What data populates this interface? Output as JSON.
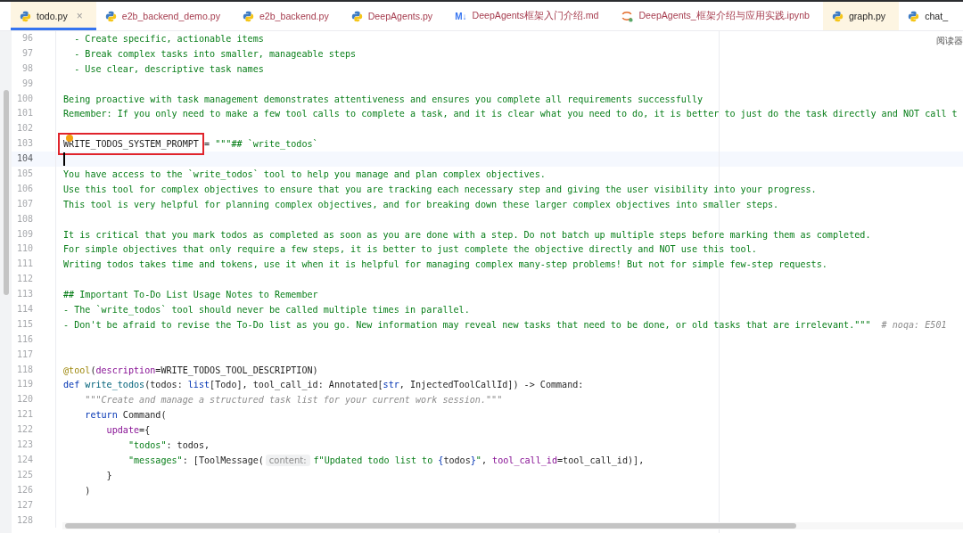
{
  "tabs": [
    {
      "label": "todo.py",
      "kind": "python",
      "selected": true,
      "highlighted": true,
      "close": "×",
      "unversioned": false
    },
    {
      "label": "e2b_backend_demo.py",
      "kind": "python",
      "selected": false,
      "highlighted": false,
      "unversioned": true
    },
    {
      "label": "e2b_backend.py",
      "kind": "python",
      "selected": false,
      "highlighted": false,
      "unversioned": true
    },
    {
      "label": "DeepAgents.py",
      "kind": "python",
      "selected": false,
      "highlighted": false,
      "unversioned": true
    },
    {
      "label": "DeepAgents框架入门介绍.md",
      "kind": "markdown",
      "badge": "M↓",
      "selected": false,
      "highlighted": false,
      "unversioned": true
    },
    {
      "label": "DeepAgents_框架介绍与应用实践.ipynb",
      "kind": "jupyter",
      "selected": false,
      "highlighted": false,
      "unversioned": true
    },
    {
      "label": "graph.py",
      "kind": "python",
      "selected": false,
      "highlighted": true,
      "unversioned": false
    },
    {
      "label": "chat_",
      "kind": "python",
      "selected": false,
      "highlighted": false,
      "unversioned": false
    }
  ],
  "reader_mode": "阅读器",
  "lines": [
    {
      "number": "96",
      "current": false,
      "caret": false,
      "marker": false,
      "tokens": [
        {
          "kind": "str",
          "text": "  - Create specific, actionable items"
        }
      ]
    },
    {
      "number": "97",
      "current": false,
      "caret": false,
      "marker": false,
      "tokens": [
        {
          "kind": "str",
          "text": "  - Break complex tasks into smaller, manageable steps"
        }
      ]
    },
    {
      "number": "98",
      "current": false,
      "caret": false,
      "marker": false,
      "tokens": [
        {
          "kind": "str",
          "text": "  - Use clear, descriptive task names"
        }
      ]
    },
    {
      "number": "99",
      "current": false,
      "caret": false,
      "marker": false
    },
    {
      "number": "100",
      "current": false,
      "caret": false,
      "marker": false,
      "tokens": [
        {
          "kind": "str",
          "text": "Being proactive with task management demonstrates attentiveness and ensures you complete all requirements successfully"
        }
      ]
    },
    {
      "number": "101",
      "current": false,
      "caret": false,
      "marker": false,
      "tokens": [
        {
          "kind": "str",
          "text": "Remember: If you only need to make a few tool calls to complete a task, and it is clear what you need to do, it is better to just do the task directly and NOT call t"
        }
      ]
    },
    {
      "number": "102",
      "current": false,
      "caret": false,
      "marker": false
    },
    {
      "number": "103",
      "current": false,
      "caret": false,
      "marker": true,
      "tokens": [
        {
          "kind": "plain",
          "text": "WRITE_TODOS_SYSTEM_PROMPT",
          "boxed": true
        },
        {
          "kind": "plain",
          "text": " = "
        },
        {
          "kind": "str",
          "text": "\"\"\"## `write_todos`"
        }
      ]
    },
    {
      "number": "104",
      "current": true,
      "caret": true,
      "marker": false
    },
    {
      "number": "105",
      "current": false,
      "caret": false,
      "marker": false,
      "tokens": [
        {
          "kind": "str",
          "text": "You have access to the `write_todos` tool to help you manage and plan complex objectives."
        }
      ]
    },
    {
      "number": "106",
      "current": false,
      "caret": false,
      "marker": false,
      "tokens": [
        {
          "kind": "str",
          "text": "Use this tool for complex objectives to ensure that you are tracking each necessary step and giving the user visibility into your progress."
        }
      ]
    },
    {
      "number": "107",
      "current": false,
      "caret": false,
      "marker": false,
      "tokens": [
        {
          "kind": "str",
          "text": "This tool is very helpful for planning complex objectives, and for breaking down these larger complex objectives into smaller steps."
        }
      ]
    },
    {
      "number": "108",
      "current": false,
      "caret": false,
      "marker": false
    },
    {
      "number": "109",
      "current": false,
      "caret": false,
      "marker": false,
      "tokens": [
        {
          "kind": "str",
          "text": "It is critical that you mark todos as completed as soon as you are done with a step. Do not batch up multiple steps before marking them as completed."
        }
      ]
    },
    {
      "number": "110",
      "current": false,
      "caret": false,
      "marker": false,
      "tokens": [
        {
          "kind": "str",
          "text": "For simple objectives that only require a few steps, it is better to just complete the objective directly and NOT use this tool."
        }
      ]
    },
    {
      "number": "111",
      "current": false,
      "caret": false,
      "marker": false,
      "tokens": [
        {
          "kind": "str",
          "text": "Writing todos takes time and tokens, use it when it is helpful for managing complex many-step problems! But not for simple few-step requests."
        }
      ]
    },
    {
      "number": "112",
      "current": false,
      "caret": false,
      "marker": false
    },
    {
      "number": "113",
      "current": false,
      "caret": false,
      "marker": false,
      "tokens": [
        {
          "kind": "str",
          "text": "## Important To-Do List Usage Notes to Remember"
        }
      ]
    },
    {
      "number": "114",
      "current": false,
      "caret": false,
      "marker": false,
      "tokens": [
        {
          "kind": "str",
          "text": "- The `write_todos` tool should never be called multiple times in parallel."
        }
      ]
    },
    {
      "number": "115",
      "current": false,
      "caret": false,
      "marker": false,
      "tokens": [
        {
          "kind": "str",
          "text": "- Don't be afraid to revise the To-Do list as you go. New information may reveal new tasks that need to be done, or old tasks that are irrelevant.\"\"\""
        },
        {
          "kind": "comment",
          "text": "  # noqa: E501"
        }
      ]
    },
    {
      "number": "116",
      "current": false,
      "caret": false,
      "marker": false
    },
    {
      "number": "117",
      "current": false,
      "caret": false,
      "marker": false
    },
    {
      "number": "118",
      "current": false,
      "caret": false,
      "marker": false,
      "tokens": [
        {
          "kind": "decorator",
          "text": "@tool"
        },
        {
          "kind": "plain",
          "text": "("
        },
        {
          "kind": "param",
          "text": "description"
        },
        {
          "kind": "plain",
          "text": "=WRITE_TODOS_TOOL_DESCRIPTION)"
        }
      ]
    },
    {
      "number": "119",
      "current": false,
      "caret": false,
      "marker": false,
      "tokens": [
        {
          "kind": "keyword",
          "text": "def"
        },
        {
          "kind": "function",
          "text": " write_todos"
        },
        {
          "kind": "plain",
          "text": "(todos: "
        },
        {
          "kind": "keyword",
          "text": "list"
        },
        {
          "kind": "plain",
          "text": "[Todo], tool_call_id: Annotated["
        },
        {
          "kind": "keyword",
          "text": "str"
        },
        {
          "kind": "plain",
          "text": ", InjectedToolCallId]) -> Command:"
        }
      ]
    },
    {
      "number": "120",
      "current": false,
      "caret": false,
      "marker": false,
      "tokens": [
        {
          "kind": "comment",
          "text": "    \"\"\"Create and manage a structured task list for your current work session.\"\"\""
        }
      ]
    },
    {
      "number": "121",
      "current": false,
      "caret": false,
      "marker": false,
      "tokens": [
        {
          "kind": "keyword",
          "text": "    return"
        },
        {
          "kind": "plain",
          "text": " Command("
        }
      ]
    },
    {
      "number": "122",
      "current": false,
      "caret": false,
      "marker": false,
      "tokens": [
        {
          "kind": "param",
          "text": "        update"
        },
        {
          "kind": "plain",
          "text": "={"
        }
      ]
    },
    {
      "number": "123",
      "current": false,
      "caret": false,
      "marker": false,
      "tokens": [
        {
          "kind": "str",
          "text": "            \"todos\""
        },
        {
          "kind": "plain",
          "text": ": todos,"
        }
      ]
    },
    {
      "number": "124",
      "current": false,
      "caret": false,
      "marker": false,
      "tokens": [
        {
          "kind": "str",
          "text": "            \"messages\""
        },
        {
          "kind": "plain",
          "text": ": [ToolMessage("
        },
        {
          "kind": "hint",
          "text": "content:"
        },
        {
          "kind": "str",
          "text": "f\"Updated todo list to "
        },
        {
          "kind": "keyword",
          "text": "{"
        },
        {
          "kind": "plain",
          "text": "todos"
        },
        {
          "kind": "keyword",
          "text": "}"
        },
        {
          "kind": "str",
          "text": "\""
        },
        {
          "kind": "plain",
          "text": ", "
        },
        {
          "kind": "param",
          "text": "tool_call_id"
        },
        {
          "kind": "plain",
          "text": "=tool_call_id)],"
        }
      ]
    },
    {
      "number": "125",
      "current": false,
      "caret": false,
      "marker": false,
      "tokens": [
        {
          "kind": "plain",
          "text": "        }"
        }
      ]
    },
    {
      "number": "126",
      "current": false,
      "caret": false,
      "marker": false,
      "tokens": [
        {
          "kind": "plain",
          "text": "    )"
        }
      ]
    },
    {
      "number": "127",
      "current": false,
      "caret": false,
      "marker": false
    },
    {
      "number": "128",
      "current": false,
      "caret": false,
      "marker": false
    }
  ]
}
